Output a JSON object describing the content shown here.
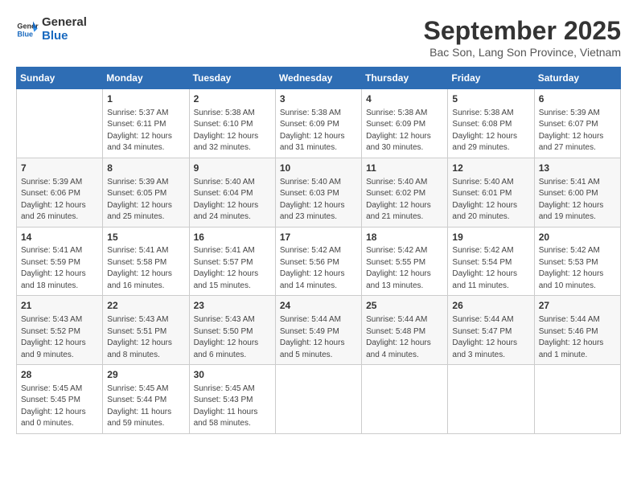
{
  "header": {
    "logo_line1": "General",
    "logo_line2": "Blue",
    "month": "September 2025",
    "location": "Bac Son, Lang Son Province, Vietnam"
  },
  "days_of_week": [
    "Sunday",
    "Monday",
    "Tuesday",
    "Wednesday",
    "Thursday",
    "Friday",
    "Saturday"
  ],
  "weeks": [
    [
      {
        "day": "",
        "info": ""
      },
      {
        "day": "1",
        "info": "Sunrise: 5:37 AM\nSunset: 6:11 PM\nDaylight: 12 hours\nand 34 minutes."
      },
      {
        "day": "2",
        "info": "Sunrise: 5:38 AM\nSunset: 6:10 PM\nDaylight: 12 hours\nand 32 minutes."
      },
      {
        "day": "3",
        "info": "Sunrise: 5:38 AM\nSunset: 6:09 PM\nDaylight: 12 hours\nand 31 minutes."
      },
      {
        "day": "4",
        "info": "Sunrise: 5:38 AM\nSunset: 6:09 PM\nDaylight: 12 hours\nand 30 minutes."
      },
      {
        "day": "5",
        "info": "Sunrise: 5:38 AM\nSunset: 6:08 PM\nDaylight: 12 hours\nand 29 minutes."
      },
      {
        "day": "6",
        "info": "Sunrise: 5:39 AM\nSunset: 6:07 PM\nDaylight: 12 hours\nand 27 minutes."
      }
    ],
    [
      {
        "day": "7",
        "info": "Sunrise: 5:39 AM\nSunset: 6:06 PM\nDaylight: 12 hours\nand 26 minutes."
      },
      {
        "day": "8",
        "info": "Sunrise: 5:39 AM\nSunset: 6:05 PM\nDaylight: 12 hours\nand 25 minutes."
      },
      {
        "day": "9",
        "info": "Sunrise: 5:40 AM\nSunset: 6:04 PM\nDaylight: 12 hours\nand 24 minutes."
      },
      {
        "day": "10",
        "info": "Sunrise: 5:40 AM\nSunset: 6:03 PM\nDaylight: 12 hours\nand 23 minutes."
      },
      {
        "day": "11",
        "info": "Sunrise: 5:40 AM\nSunset: 6:02 PM\nDaylight: 12 hours\nand 21 minutes."
      },
      {
        "day": "12",
        "info": "Sunrise: 5:40 AM\nSunset: 6:01 PM\nDaylight: 12 hours\nand 20 minutes."
      },
      {
        "day": "13",
        "info": "Sunrise: 5:41 AM\nSunset: 6:00 PM\nDaylight: 12 hours\nand 19 minutes."
      }
    ],
    [
      {
        "day": "14",
        "info": "Sunrise: 5:41 AM\nSunset: 5:59 PM\nDaylight: 12 hours\nand 18 minutes."
      },
      {
        "day": "15",
        "info": "Sunrise: 5:41 AM\nSunset: 5:58 PM\nDaylight: 12 hours\nand 16 minutes."
      },
      {
        "day": "16",
        "info": "Sunrise: 5:41 AM\nSunset: 5:57 PM\nDaylight: 12 hours\nand 15 minutes."
      },
      {
        "day": "17",
        "info": "Sunrise: 5:42 AM\nSunset: 5:56 PM\nDaylight: 12 hours\nand 14 minutes."
      },
      {
        "day": "18",
        "info": "Sunrise: 5:42 AM\nSunset: 5:55 PM\nDaylight: 12 hours\nand 13 minutes."
      },
      {
        "day": "19",
        "info": "Sunrise: 5:42 AM\nSunset: 5:54 PM\nDaylight: 12 hours\nand 11 minutes."
      },
      {
        "day": "20",
        "info": "Sunrise: 5:42 AM\nSunset: 5:53 PM\nDaylight: 12 hours\nand 10 minutes."
      }
    ],
    [
      {
        "day": "21",
        "info": "Sunrise: 5:43 AM\nSunset: 5:52 PM\nDaylight: 12 hours\nand 9 minutes."
      },
      {
        "day": "22",
        "info": "Sunrise: 5:43 AM\nSunset: 5:51 PM\nDaylight: 12 hours\nand 8 minutes."
      },
      {
        "day": "23",
        "info": "Sunrise: 5:43 AM\nSunset: 5:50 PM\nDaylight: 12 hours\nand 6 minutes."
      },
      {
        "day": "24",
        "info": "Sunrise: 5:44 AM\nSunset: 5:49 PM\nDaylight: 12 hours\nand 5 minutes."
      },
      {
        "day": "25",
        "info": "Sunrise: 5:44 AM\nSunset: 5:48 PM\nDaylight: 12 hours\nand 4 minutes."
      },
      {
        "day": "26",
        "info": "Sunrise: 5:44 AM\nSunset: 5:47 PM\nDaylight: 12 hours\nand 3 minutes."
      },
      {
        "day": "27",
        "info": "Sunrise: 5:44 AM\nSunset: 5:46 PM\nDaylight: 12 hours\nand 1 minute."
      }
    ],
    [
      {
        "day": "28",
        "info": "Sunrise: 5:45 AM\nSunset: 5:45 PM\nDaylight: 12 hours\nand 0 minutes."
      },
      {
        "day": "29",
        "info": "Sunrise: 5:45 AM\nSunset: 5:44 PM\nDaylight: 11 hours\nand 59 minutes."
      },
      {
        "day": "30",
        "info": "Sunrise: 5:45 AM\nSunset: 5:43 PM\nDaylight: 11 hours\nand 58 minutes."
      },
      {
        "day": "",
        "info": ""
      },
      {
        "day": "",
        "info": ""
      },
      {
        "day": "",
        "info": ""
      },
      {
        "day": "",
        "info": ""
      }
    ]
  ]
}
